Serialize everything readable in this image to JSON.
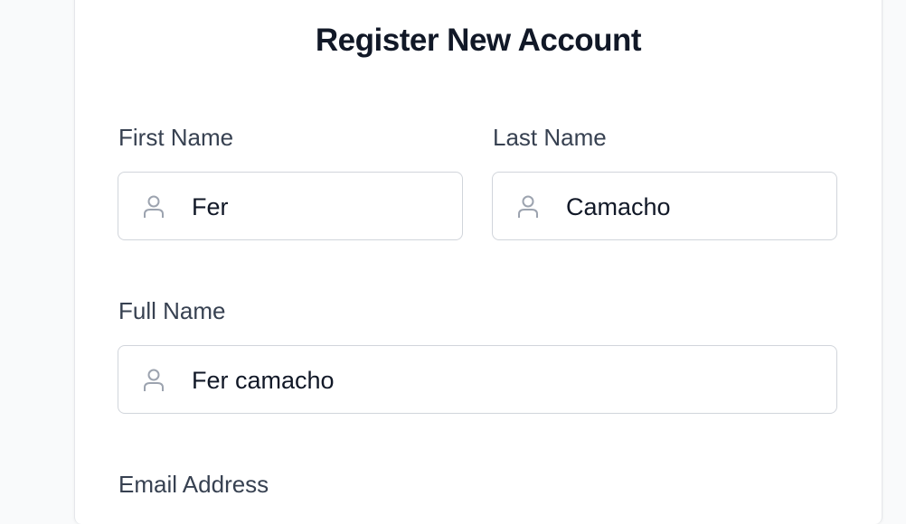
{
  "form": {
    "title": "Register New Account",
    "first_name": {
      "label": "First Name",
      "value": "Fer"
    },
    "last_name": {
      "label": "Last Name",
      "value": "Camacho"
    },
    "full_name": {
      "label": "Full Name",
      "value": "Fer camacho"
    },
    "email": {
      "label": "Email Address"
    }
  },
  "icons": {
    "field_icon": "user-icon"
  },
  "colors": {
    "background": "#f9fafb",
    "card": "#ffffff",
    "title": "#111827",
    "label": "#374151",
    "border": "#d1d5db",
    "icon": "#9ca3af"
  }
}
